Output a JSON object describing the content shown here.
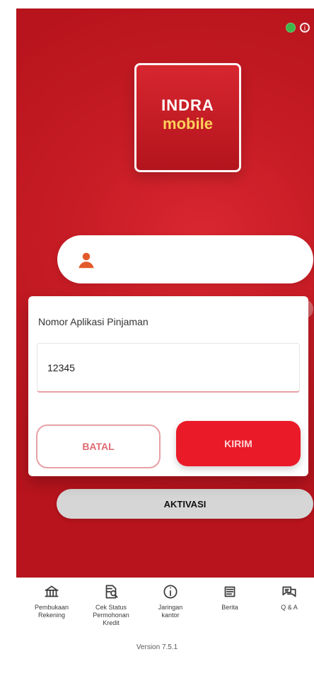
{
  "header": {
    "status_icons": [
      "status-online-icon",
      "info-icon"
    ]
  },
  "brand": {
    "line1": "INDRA",
    "line2": "mobile",
    "colors": {
      "background": "#c71c25",
      "accent": "#ffd15a",
      "text_white": "#ffffff"
    }
  },
  "login": {
    "username": {
      "icon": "user-icon"
    },
    "activate_label": "AKTIVASI"
  },
  "dialog": {
    "title": "Nomor Aplikasi Pinjaman",
    "input_value": "12345",
    "buttons": {
      "cancel": "BATAL",
      "submit": "KIRIM"
    },
    "colors": {
      "submit": "#ea1a29",
      "cancel_border": "#e7a0a5"
    }
  },
  "bottom_nav": {
    "items": [
      {
        "icon": "bank-account-icon",
        "label": "Pembukaan\nRekening"
      },
      {
        "icon": "search-status-icon",
        "label": "Cek Status\nPermohonan\nKredit"
      },
      {
        "icon": "info-icon",
        "label": "Jaringan\nkantor"
      },
      {
        "icon": "news-icon",
        "label": "Berita"
      },
      {
        "icon": "faq-icon",
        "label": "Q & A"
      }
    ]
  },
  "footer": {
    "version": "Version 7.5.1"
  }
}
